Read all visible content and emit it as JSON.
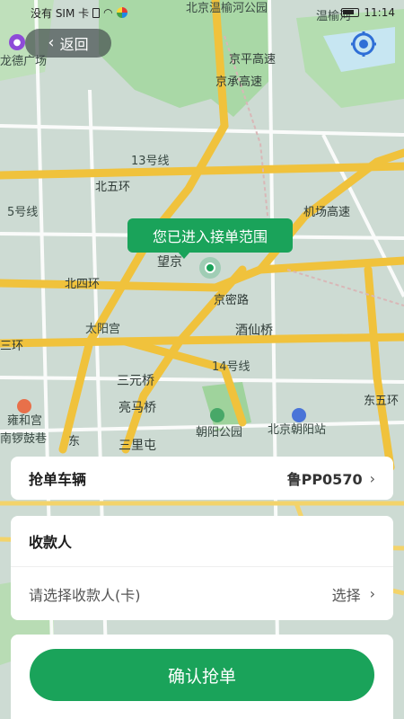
{
  "status_bar": {
    "sim": "没有 SIM 卡",
    "time": "11:14"
  },
  "header": {
    "back_label": "返回"
  },
  "map": {
    "labels": {
      "wenyu_park": "北京温榆河公园",
      "wenyu_river": "温榆河",
      "longde": "龙德广场",
      "jingping": "京平高速",
      "jingcheng": "京承高速",
      "line13": "13号线",
      "beiwuhuan": "北五环",
      "line5": "5号线",
      "airport": "机场高速",
      "wangjing": "望京",
      "beisihuan": "北四环",
      "jingmi": "京密路",
      "taiyanggong": "太阳宫",
      "jiuxianqiao": "酒仙桥",
      "sanhuan": "三环",
      "line14": "14号线",
      "sanyuanqiao": "三元桥",
      "liangmaqiao": "亮马桥",
      "yonghegong": "雍和宫",
      "nanluoguxiang": "南锣鼓巷",
      "chaoyang_park": "朝阳公园",
      "beijing_chaoyang": "北京朝阳站",
      "dongwuhuan": "东五环",
      "sanlitun": "三里屯",
      "dong": "东"
    },
    "tooltip": "您已进入接单范围",
    "accent": "#1aa35a"
  },
  "vehicle": {
    "title": "抢单车辆",
    "plate": "鲁PP0570"
  },
  "payee": {
    "title": "收款人",
    "placeholder": "请选择收款人(卡)",
    "action": "选择"
  },
  "confirm": {
    "label": "确认抢单"
  }
}
